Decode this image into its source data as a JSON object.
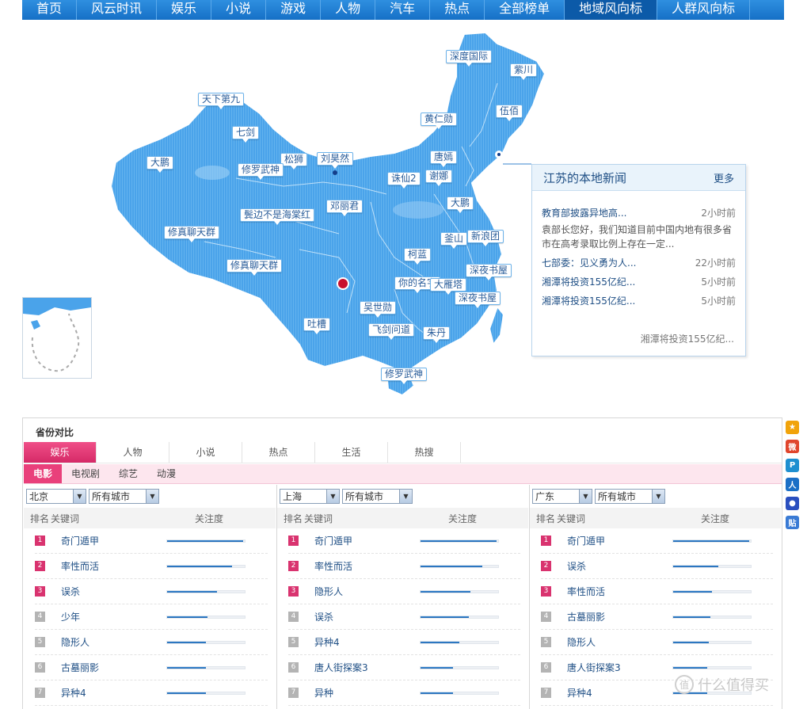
{
  "nav": {
    "items": [
      "首页",
      "风云时讯",
      "娱乐",
      "小说",
      "游戏",
      "人物",
      "汽车",
      "热点",
      "全部榜单",
      "地域风向标",
      "人群风向标"
    ],
    "active_index": 9
  },
  "map": {
    "labels": [
      "深度国际",
      "紫川",
      "天下第九",
      "伍佰",
      "黄仁勋",
      "七剑",
      "大鹏",
      "松狮",
      "刘昊然",
      "唐嫣",
      "修罗武神",
      "诛仙2",
      "谢娜",
      "鬓边不是海棠红",
      "邓丽君",
      "大鹏",
      "修真聊天群",
      "釜山",
      "新浪团",
      "柯蓝",
      "修真聊天群",
      "深夜书屋",
      "你的名字",
      "大雁塔",
      "深夜书屋",
      "吴世勋",
      "吐槽",
      "飞剑问道",
      "朱丹",
      "修罗武神"
    ],
    "colors": {
      "land": "#4aa3ea",
      "land_light": "#7cc0f2",
      "border": "#cfe6fa",
      "accent": "#c8102e"
    }
  },
  "news": {
    "title": "江苏的本地新闻",
    "more": "更多",
    "items": [
      {
        "title": "教育部披露异地高...",
        "time": "2小时前",
        "desc": "袁部长您好，我们知道目前中国内地有很多省市在高考录取比例上存在一定..."
      },
      {
        "title": "七部委：见义勇为人...",
        "time": "22小时前"
      },
      {
        "title": "湘潭将投资155亿纪...",
        "time": "5小时前"
      },
      {
        "title": "湘潭将投资155亿纪...",
        "time": "5小时前"
      }
    ],
    "footer": "湘潭将投资155亿纪..."
  },
  "compare": {
    "title": "省份对比",
    "categories": [
      "娱乐",
      "人物",
      "小说",
      "热点",
      "生活",
      "热搜"
    ],
    "subtabs": [
      "电影",
      "电视剧",
      "综艺",
      "动漫"
    ],
    "headers": {
      "rank": "排名",
      "keyword": "关键词",
      "attention": "关注度"
    },
    "columns": [
      {
        "province": "北京",
        "city": "所有城市",
        "rows": [
          {
            "rank": "1",
            "keyword": "奇门遁甲",
            "attention": 0.98
          },
          {
            "rank": "2",
            "keyword": "率性而活",
            "attention": 0.84
          },
          {
            "rank": "3",
            "keyword": "误杀",
            "attention": 0.64
          },
          {
            "rank": "4",
            "keyword": "少年",
            "attention": 0.52
          },
          {
            "rank": "5",
            "keyword": "隐形人",
            "attention": 0.5
          },
          {
            "rank": "6",
            "keyword": "古墓丽影",
            "attention": 0.5
          },
          {
            "rank": "7",
            "keyword": "异种4",
            "attention": 0.5
          }
        ]
      },
      {
        "province": "上海",
        "city": "所有城市",
        "rows": [
          {
            "rank": "1",
            "keyword": "奇门遁甲",
            "attention": 0.98
          },
          {
            "rank": "2",
            "keyword": "率性而活",
            "attention": 0.8
          },
          {
            "rank": "3",
            "keyword": "隐形人",
            "attention": 0.64
          },
          {
            "rank": "4",
            "keyword": "误杀",
            "attention": 0.62
          },
          {
            "rank": "5",
            "keyword": "异种4",
            "attention": 0.5
          },
          {
            "rank": "6",
            "keyword": "唐人街探案3",
            "attention": 0.42
          },
          {
            "rank": "7",
            "keyword": "异种",
            "attention": 0.42
          }
        ]
      },
      {
        "province": "广东",
        "city": "所有城市",
        "rows": [
          {
            "rank": "1",
            "keyword": "奇门遁甲",
            "attention": 0.98
          },
          {
            "rank": "2",
            "keyword": "误杀",
            "attention": 0.58
          },
          {
            "rank": "3",
            "keyword": "率性而活",
            "attention": 0.5
          },
          {
            "rank": "4",
            "keyword": "古墓丽影",
            "attention": 0.48
          },
          {
            "rank": "5",
            "keyword": "隐形人",
            "attention": 0.46
          },
          {
            "rank": "6",
            "keyword": "唐人街探案3",
            "attention": 0.44
          },
          {
            "rank": "7",
            "keyword": "异种4",
            "attention": 0.44
          }
        ]
      }
    ]
  },
  "share": {
    "icons": [
      "qzone-icon",
      "weibo-icon",
      "tencent-weibo-icon",
      "renren-icon",
      "baidu-icon",
      "tieba-icon"
    ],
    "glyphs": [
      "★",
      "微",
      "P",
      "人",
      "●",
      "贴"
    ],
    "colors": [
      "#f1a30a",
      "#e0452c",
      "#1e8fd0",
      "#1b6fc6",
      "#2a4fbf",
      "#3a7bd5"
    ]
  },
  "watermark": {
    "text": "什么值得买",
    "icon_glyph": "值"
  }
}
